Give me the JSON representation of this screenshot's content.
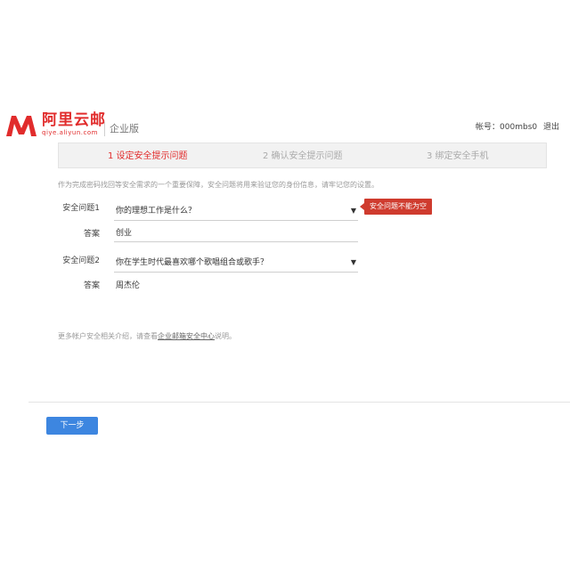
{
  "header": {
    "logo_cn": "阿里云邮",
    "logo_en": "qiye.aliyun.com",
    "edition": "企业版",
    "account_label": "帐号：",
    "account_value": "000mbs0",
    "logout": "退出"
  },
  "steps": [
    {
      "label": "1 设定安全提示问题",
      "active": true
    },
    {
      "label": "2 确认安全提示问题",
      "active": false
    },
    {
      "label": "3 绑定安全手机",
      "active": false
    }
  ],
  "intro": "作为完成密码找回等安全需求的一个重要保障，安全问题将用来验证您的身份信息，请牢记您的设置。",
  "form": {
    "q1_label": "安全问题1",
    "q1_value": "你的理想工作是什么？",
    "a1_label": "答案",
    "a1_value": "创业",
    "q2_label": "安全问题2",
    "q2_value": "你在学生时代最喜欢哪个歌唱组合或歌手？",
    "a2_label": "答案",
    "a2_value": "周杰伦",
    "error_tip": "安全问题不能为空"
  },
  "note": {
    "prefix": "更多帐户安全相关介绍，请查看",
    "link": "企业邮箱安全中心",
    "suffix": "说明。"
  },
  "next_button": "下一步",
  "colors": {
    "brand": "#e12c2c",
    "primary_button": "#3d86e0",
    "tooltip_bg": "#cf3b2e"
  }
}
